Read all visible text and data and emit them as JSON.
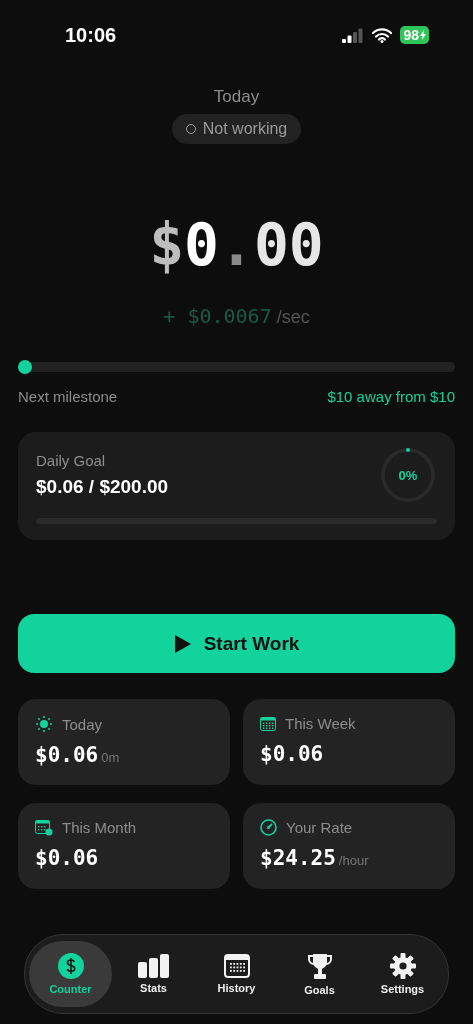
{
  "status_bar": {
    "time": "10:06",
    "battery": "98"
  },
  "header": {
    "label": "Today",
    "status": {
      "text": "Not working",
      "working": false
    }
  },
  "counter": {
    "currency": "$",
    "whole": "0",
    "point": ".",
    "cents": "00"
  },
  "rate": {
    "sign": "+",
    "amount": "$0.0067",
    "unit": "/sec"
  },
  "milestone": {
    "level": 0.0,
    "label": "Next milestone",
    "note": "$10 away from $10"
  },
  "daily_goal": {
    "title": "Daily Goal",
    "value": "$0.06 / $200.00",
    "percent": "0%"
  },
  "start_button": {
    "label": "Start Work"
  },
  "stats": [
    {
      "kind": "sun",
      "label": "Today",
      "value": "$0.06",
      "unit": "0m"
    },
    {
      "kind": "week",
      "label": "This Week",
      "value": "$0.06"
    },
    {
      "kind": "month",
      "label": "This Month",
      "value": "$0.06"
    },
    {
      "kind": "gauge",
      "label": "Your Rate",
      "value": "$24.25",
      "unit": "/hour"
    }
  ],
  "tabs": [
    {
      "kind": "dollar",
      "label": "Counter",
      "selected": true
    },
    {
      "kind": "bars",
      "label": "Stats",
      "selected": false
    },
    {
      "kind": "calendar",
      "label": "History",
      "selected": false
    },
    {
      "kind": "trophy",
      "label": "Goals",
      "selected": false
    },
    {
      "kind": "gear",
      "label": "Settings",
      "selected": false
    }
  ]
}
